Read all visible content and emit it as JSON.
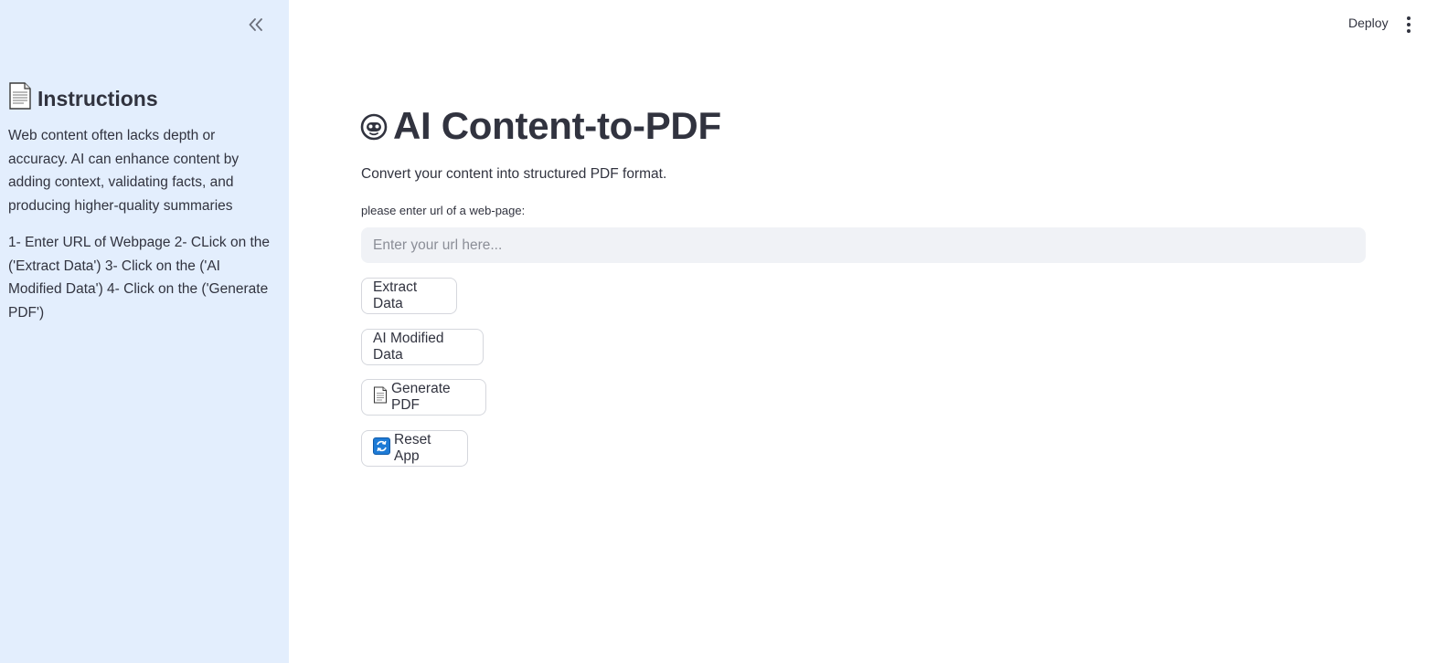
{
  "sidebar": {
    "heading": "Instructions",
    "heading_icon": "document-icon",
    "collapse_icon": "double-chevron-left-icon",
    "paragraph_1": "Web content often lacks depth or accuracy. AI can enhance content by adding context, validating facts, and producing higher-quality summaries",
    "paragraph_2": "1- Enter URL of Webpage 2- CLick on the ('Extract Data') 3- Click on the ('AI Modified Data') 4- Click on the ('Generate PDF')"
  },
  "header": {
    "deploy_label": "Deploy",
    "menu_icon": "kebab-menu-icon"
  },
  "main": {
    "title": "AI Content-to-PDF",
    "title_icon": "robot-face-icon",
    "subtitle": "Convert your content into structured PDF format.",
    "url_label": "please enter url of a web-page:",
    "url_placeholder": "Enter your url here...",
    "url_value": "",
    "buttons": {
      "extract": "Extract Data",
      "ai_modified": "AI Modified Data",
      "generate_pdf": "Generate PDF",
      "reset": "Reset App"
    }
  },
  "colors": {
    "sidebar_bg": "#e3eefd",
    "text": "#31333f",
    "input_bg": "#f0f2f6",
    "reset_icon_bg": "#1e7bd6"
  }
}
